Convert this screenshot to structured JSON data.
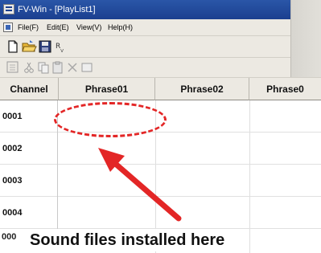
{
  "window": {
    "title": "FV-Win - [PlayList1]"
  },
  "menu": {
    "items": [
      "File(F)",
      "Edit(E)",
      "View(V)",
      "Help(H)"
    ]
  },
  "toolbar": {
    "row1_icons": [
      "new-document-icon",
      "open-folder-icon",
      "save-icon",
      "properties-icon"
    ],
    "row2_icons": [
      "insert-row-icon",
      "cut-icon",
      "copy-icon",
      "paste-icon",
      "delete-icon",
      "clear-icon"
    ]
  },
  "grid": {
    "columns": [
      "Channel",
      "Phrase01",
      "Phrase02",
      "Phrase0"
    ],
    "rows": [
      {
        "channel": "0001"
      },
      {
        "channel": "0002"
      },
      {
        "channel": "0003"
      },
      {
        "channel": "0004"
      },
      {
        "channel": "000"
      }
    ]
  },
  "annotation": {
    "caption": "Sound files installed here",
    "color": "#e32626"
  }
}
